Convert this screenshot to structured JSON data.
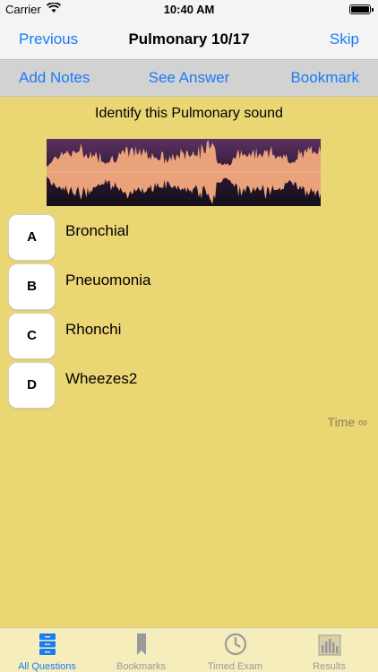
{
  "status": {
    "carrier": "Carrier",
    "time": "10:40 AM"
  },
  "nav": {
    "prev_label": "Previous",
    "title": "Pulmonary 10/17",
    "skip_label": "Skip"
  },
  "toolbar": {
    "notes_label": "Add Notes",
    "answer_label": "See Answer",
    "bookmark_label": "Bookmark"
  },
  "prompt": "Identify this Pulmonary sound",
  "options": [
    {
      "key": "A",
      "label": "Bronchial"
    },
    {
      "key": "B",
      "label": "Pneuomonia"
    },
    {
      "key": "C",
      "label": "Rhonchi"
    },
    {
      "key": "D",
      "label": "Wheezes2"
    }
  ],
  "timer": "Time ∞",
  "tabs": [
    {
      "label": "All Questions",
      "icon": "list-icon",
      "active": true
    },
    {
      "label": "Bookmarks",
      "icon": "bookmark-icon",
      "active": false
    },
    {
      "label": "Timed Exam",
      "icon": "clock-icon",
      "active": false
    },
    {
      "label": "Results",
      "icon": "bar-chart-icon",
      "active": false
    }
  ],
  "colors": {
    "accent": "#1a7cf5",
    "background": "#ebd674",
    "waveform": "#e9a27a"
  }
}
